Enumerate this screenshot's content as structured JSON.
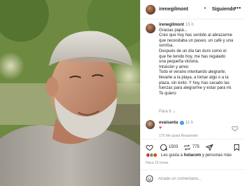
{
  "post": {
    "username": "irenegilmont",
    "dot": "•",
    "follow_label": "Siguiendo",
    "more_label": "•••",
    "photo_alt_icon": "photo-man-with-cap"
  },
  "caption": {
    "username": "irenegilmont",
    "time": "15 h",
    "lines": [
      "Gracias papá...",
      "Creo que hoy has sentido al abrazarme",
      "que necesitaba un paseo, un café y una",
      "sonrisa.",
      "Después de un día tan duro como el",
      "que he tenido hoy, me has regalado",
      "una pequeña victoria.",
      "Intuición y amor.",
      "Todo el verano intentando alegrarte,",
      "llevarte a la playa, a tomar algo o a la",
      "plaza, sin éxito. Y hoy, has sacado las",
      "fuerzas para alegrarme y estar para mi.",
      "Te quiero"
    ],
    "translate_label": "Para ti ⌄"
  },
  "comment": {
    "username": "evaisanta",
    "verified_icon": "verified-badge-icon",
    "time": "11 h",
    "text": "♥",
    "likes_label": "170 Me gusta  Responder"
  },
  "actions": {
    "comments_count": "1503",
    "shares_count": "775"
  },
  "likes": {
    "prefix": "Les gusta a ",
    "user": "holacom",
    "suffix": " y personas más"
  },
  "post_time": "Hace 15 horas",
  "add_comment": {
    "placeholder": "Añade un comentario..."
  },
  "colors": {
    "verified": "#3897f0",
    "heart": "#ed4956",
    "secondary_text": "#8e8e8e"
  }
}
